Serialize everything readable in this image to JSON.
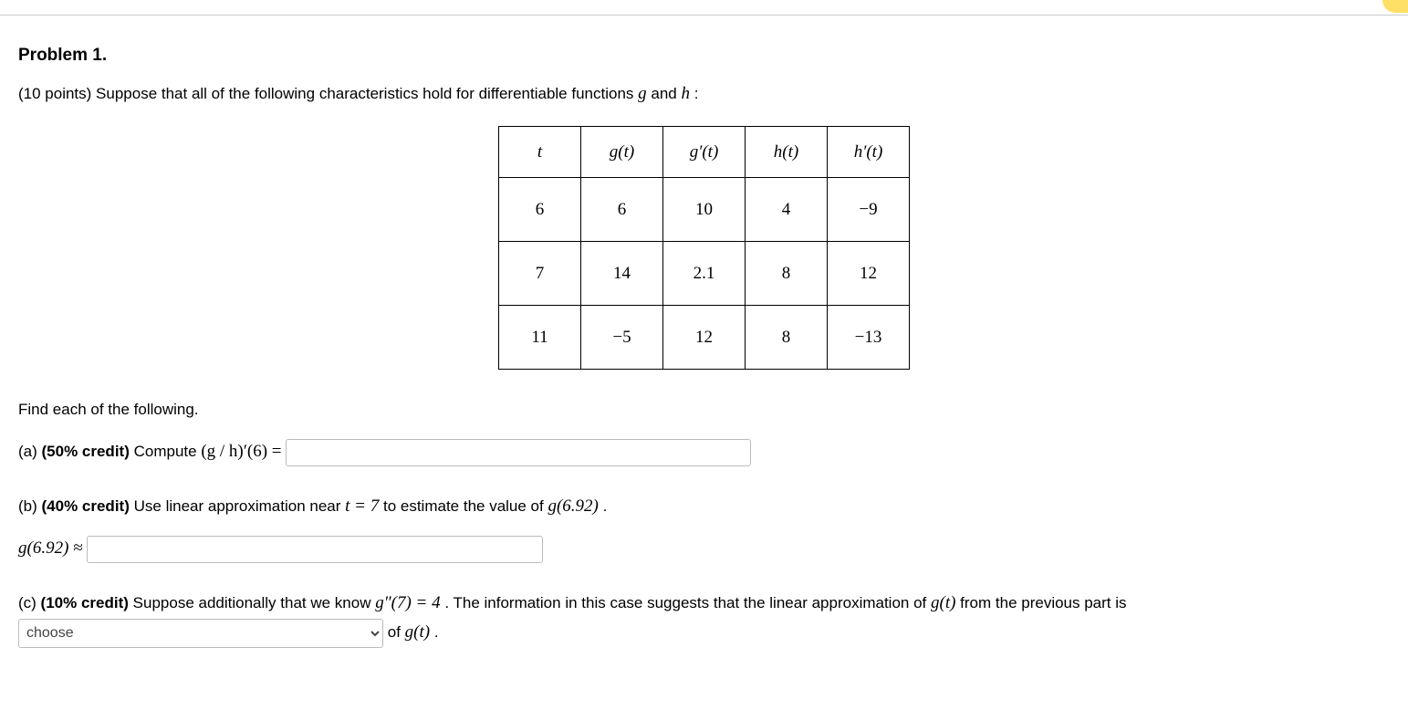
{
  "problem": {
    "title": "Problem 1.",
    "intro_prefix": "(10 points) Suppose that all of the following characteristics hold for differentiable functions ",
    "intro_g": "g",
    "intro_and": " and ",
    "intro_h": "h",
    "intro_suffix": ":"
  },
  "table": {
    "headers": {
      "c0": "t",
      "c1": "g(t)",
      "c2": "g′(t)",
      "c3": "h(t)",
      "c4": "h′(t)"
    },
    "rows": [
      {
        "c0": "6",
        "c1": "6",
        "c2": "10",
        "c3": "4",
        "c4": "−9"
      },
      {
        "c0": "7",
        "c1": "14",
        "c2": "2.1",
        "c3": "8",
        "c4": "12"
      },
      {
        "c0": "11",
        "c1": "−5",
        "c2": "12",
        "c3": "8",
        "c4": "−13"
      }
    ]
  },
  "find_line": "Find each of the following.",
  "part_a": {
    "label": "(a) ",
    "credit": "(50% credit)",
    "text_before": " Compute ",
    "math": "(g / h)′(6) = ",
    "value": ""
  },
  "part_b": {
    "label": "(b) ",
    "credit": "(40% credit)",
    "text1": " Use linear approximation near ",
    "math1": "t = 7",
    "text2": " to estimate the value of ",
    "math2": "g(6.92)",
    "period": ".",
    "result_label": "g(6.92) ≈ ",
    "value": ""
  },
  "part_c": {
    "label": "(c) ",
    "credit": "(10% credit)",
    "text1": " Suppose additionally that we know ",
    "math1": "g″(7) = 4",
    "text2": ". The information in this case suggests that the linear approximation of ",
    "math2": "g(t)",
    "text3": " from the previous part is",
    "select_placeholder": "choose",
    "text4": " of ",
    "math3": "g(t)",
    "period": "."
  }
}
